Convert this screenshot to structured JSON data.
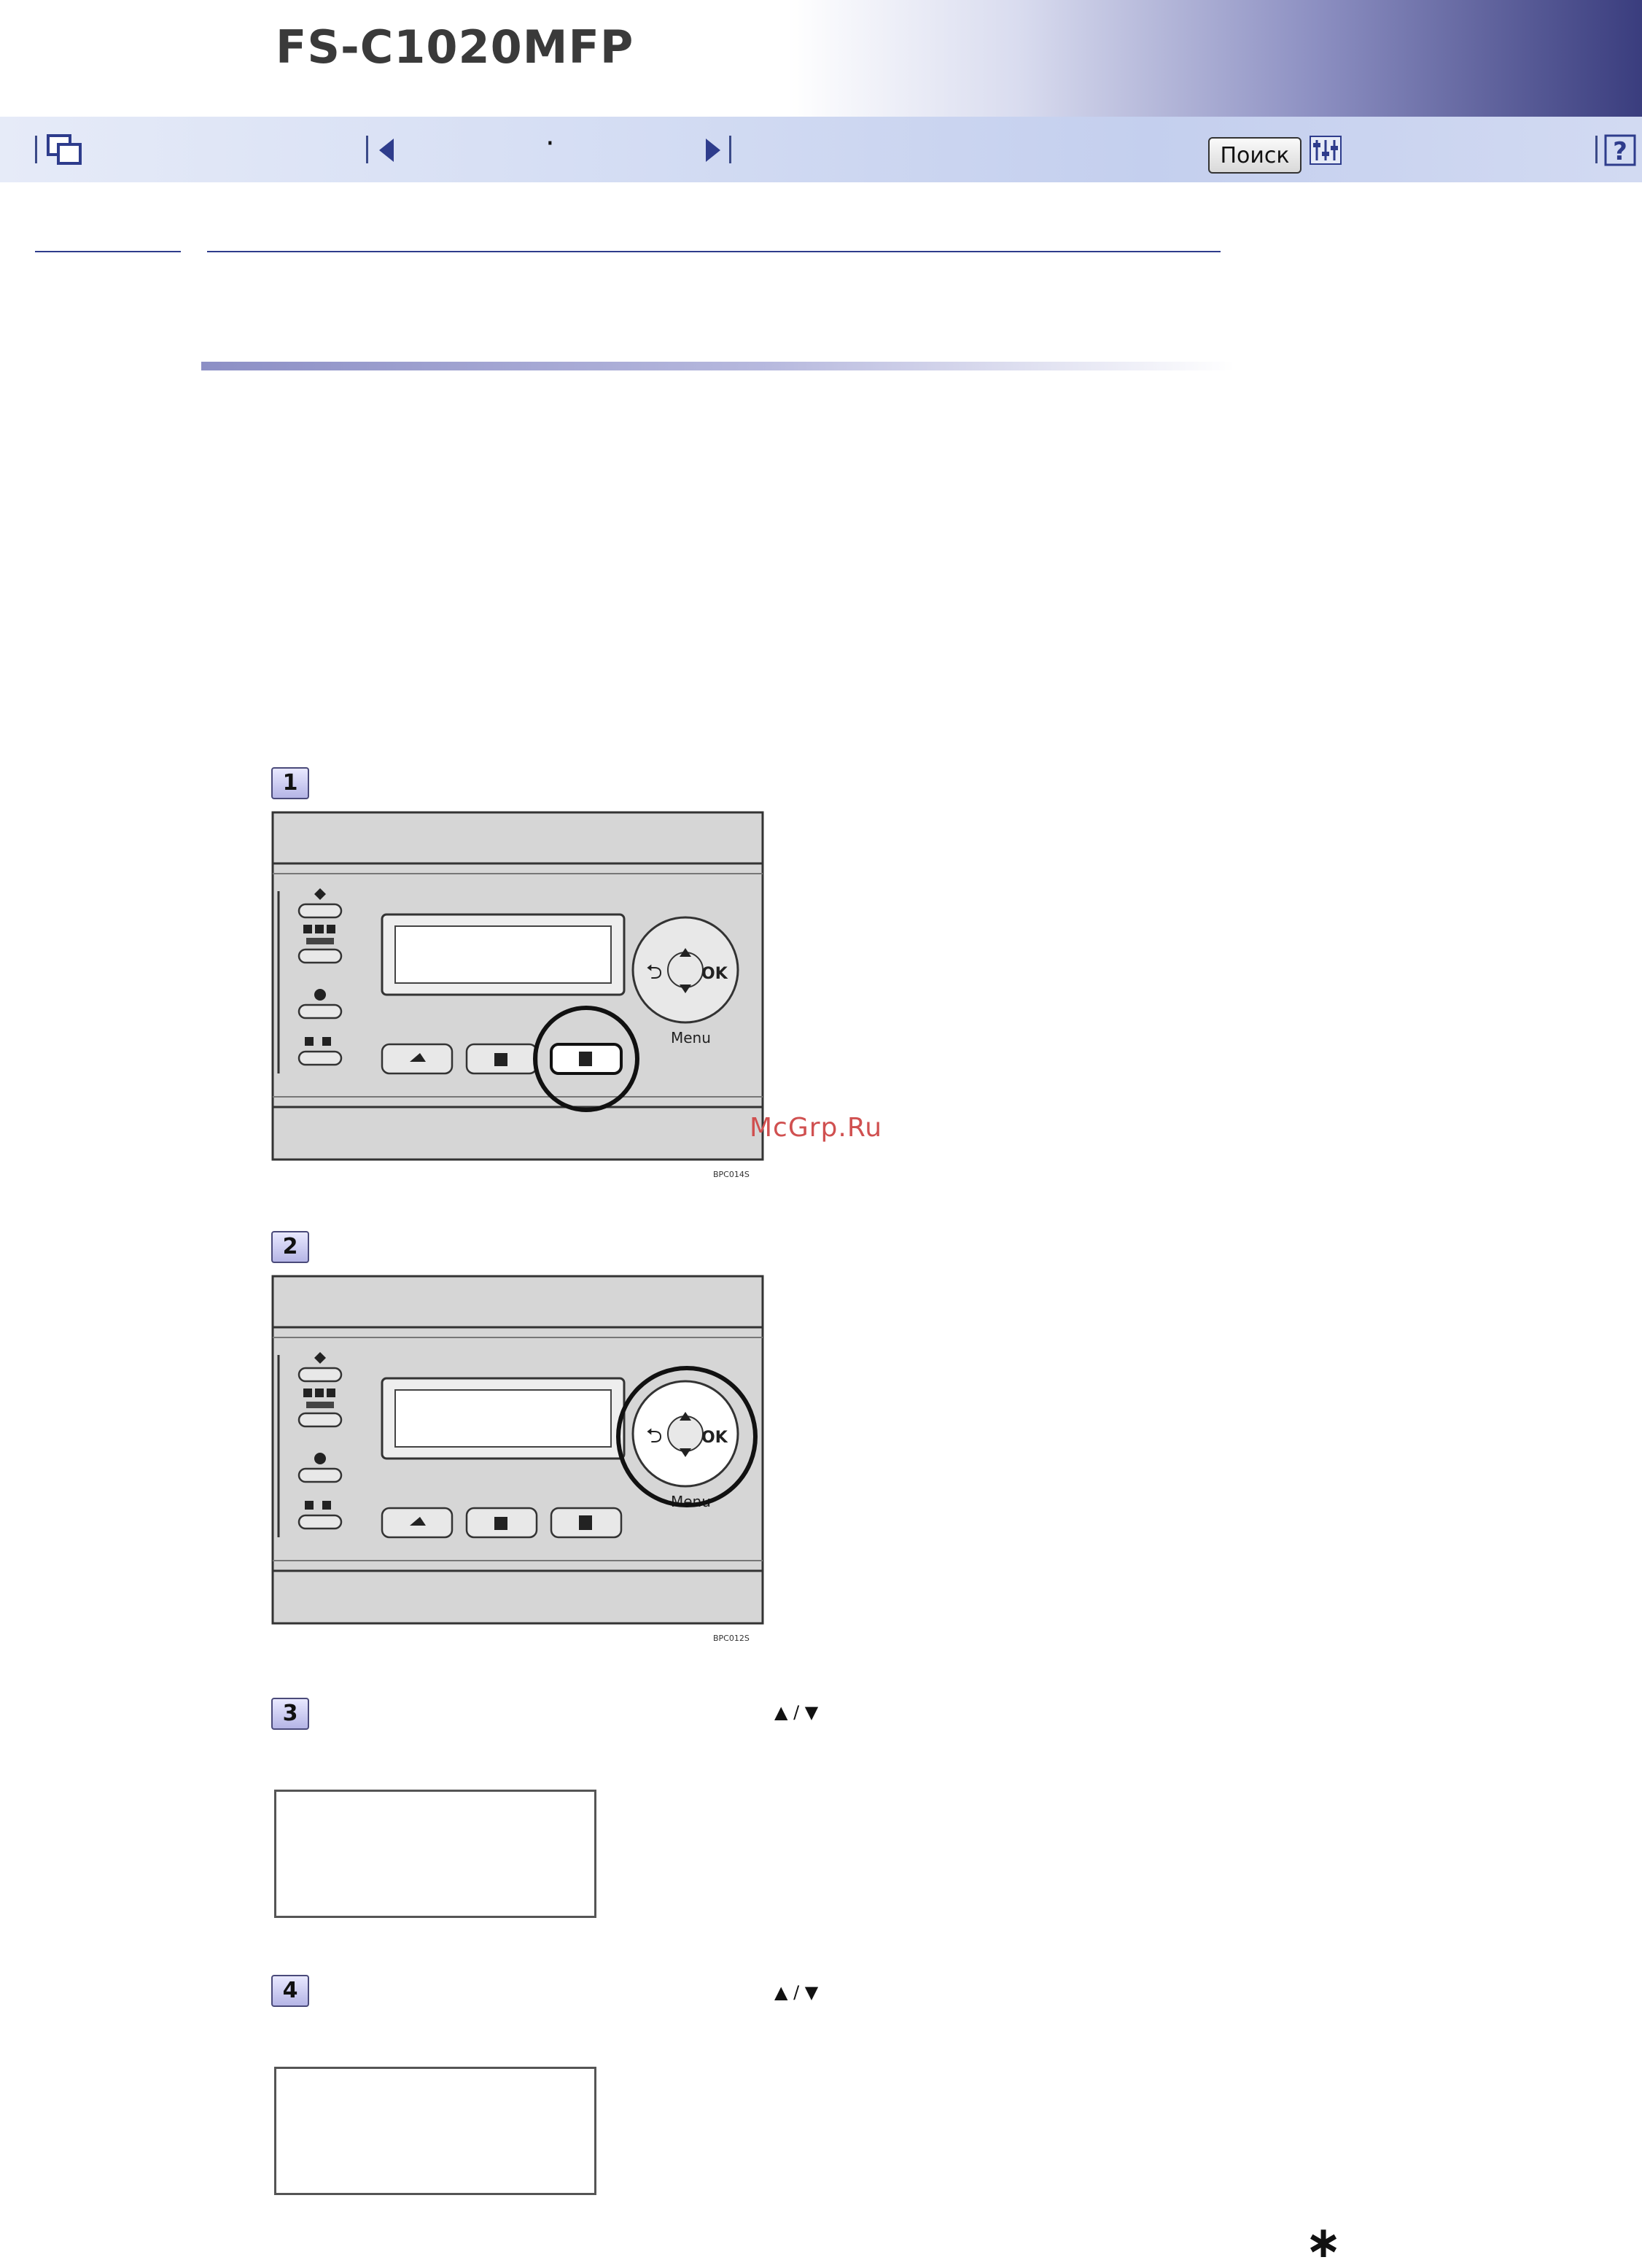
{
  "header": {
    "brand": "FS-C1020MFP"
  },
  "navbar": {
    "page_dot": "·",
    "search_label": "Поиск",
    "icons": [
      "copy-pages-icon",
      "previous-page-icon",
      "next-page-icon",
      "settings-icon",
      "help-icon"
    ]
  },
  "steps": [
    {
      "number": "1",
      "image_code": "BPC014S",
      "highlight": "copy-key"
    },
    {
      "number": "2",
      "image_code": "BPC012S",
      "highlight": "navigation-keys"
    },
    {
      "number": "3",
      "arrows": "▲ / ▼"
    },
    {
      "number": "4",
      "arrows": "▲ / ▼"
    }
  ],
  "panel_labels": {
    "ok": "OK",
    "menu": "Menu"
  },
  "watermark": "McGrp.Ru",
  "footnote_mark": "∗"
}
